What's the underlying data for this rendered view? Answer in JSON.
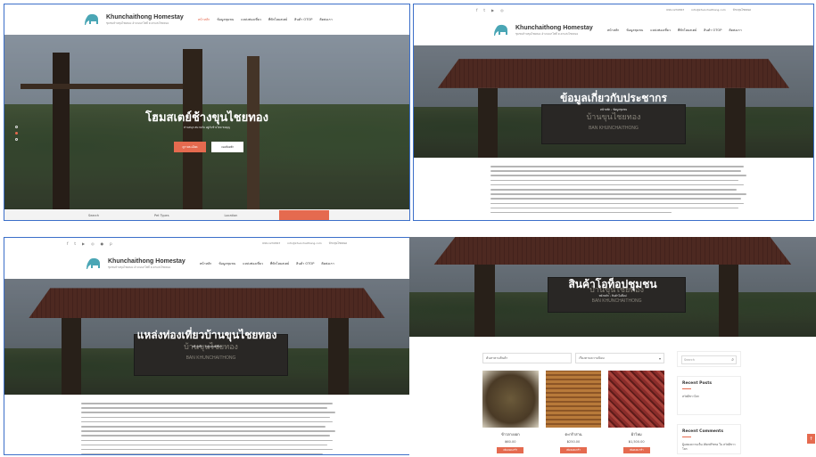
{
  "site": {
    "brand_name": "Khunchaithong Homestay",
    "brand_tagline": "ชุมชนบ้านขุนไชยทอง อำเภอนาโพธิ์ ต.ตาแสงไชยทอง",
    "nav": [
      "หน้าหลัก",
      "ข้อมูลชุมชน",
      "แหล่งท่องเที่ยว",
      "ที่พักโฮมสเตย์",
      "สินค้า OTOP",
      "ติดต่อเรา"
    ],
    "contact": [
      "099-1234567",
      "info@khunchaithong.com",
      "บ้านขุนไชยทอง"
    ]
  },
  "panel1": {
    "hero_title": "โฮมสเตย์ช้างขุนไชยทอง",
    "hero_subtitle": "ท่านสนุก สนานกับ อยู่กับช้างไทย ชมบุญ",
    "btn_primary": "ดูรายละเอียด",
    "btn_secondary": "จองห้องพัก",
    "search_labels": [
      "Search",
      "Pet Types",
      "Location"
    ]
  },
  "panel2": {
    "hero_title": "ข้อมูลเกี่ยวกับประชากร",
    "breadcrumb": "หน้าหลัก › ข้อมูลชุมชน"
  },
  "panel3": {
    "hero_title": "แหล่งท่องเที่ยวบ้านขุนไชยทอง",
    "breadcrumb": "หน้าหลัก › แหล่งท่องเที่ยว"
  },
  "panel4": {
    "hero_title": "สินค้าโอท็อปชุมชน",
    "breadcrumb": "หน้าหลัก › สินค้าโอท็อป",
    "sort_placeholder": "เรียงตามความนิยม",
    "filter_label": "ค้นหาตามสินค้า",
    "search_placeholder": "Search",
    "products": [
      {
        "name": "ข้าวฮางงอก",
        "price": "฿60.00",
        "button": "เพิ่มลงตะกร้า"
      },
      {
        "name": "ตะกร้าสาน",
        "price": "฿250.00",
        "button": "เพิ่มลงตะกร้า"
      },
      {
        "name": "ผ้าไหม",
        "price": "฿1,500.00",
        "button": "เพิ่มลงตะกร้า"
      }
    ],
    "recent_posts_title": "Recent Posts",
    "recent_posts": [
      "สวัสดีชาวโลก"
    ],
    "recent_comments_title": "Recent Comments",
    "recent_comments": [
      "ผู้แสดงความเห็น WordPress ใน สวัสดีชาวโลก"
    ]
  },
  "sign_text": {
    "thai": "บ้านขุนไชยทอง",
    "english": "BAN KHUNCHAITHONG"
  },
  "colors": {
    "accent": "#e56a4f",
    "panel_border": "#3c6fc9",
    "roof": "#7d3b2c"
  }
}
